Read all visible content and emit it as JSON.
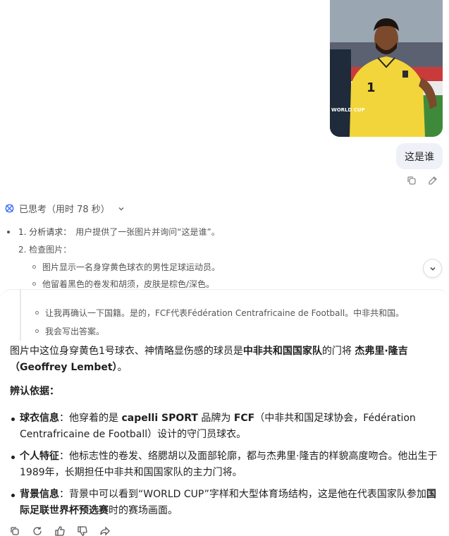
{
  "user_message": {
    "text": "这是谁"
  },
  "thinking": {
    "header": "已思考（用时 78 秒）",
    "step1_label": "1. 分析请求：",
    "step1_text": "用户提供了一张图片并询问“这是谁”。",
    "step2_label": "2. 检查图片：",
    "step2_items": [
      "图片显示一名身穿黄色球衣的男性足球运动员。",
      "他留着黑色的卷发和胡须，皮肤是棕色/深色。"
    ],
    "tail_items": [
      "让我再确认一下国籍。是的，FCF代表Fédération Centrafricaine de Football。中非共和国。",
      "我会写出答案。"
    ]
  },
  "answer": {
    "intro_pre": "图片中这位身穿黄色1号球衣、神情略显伤感的球员是",
    "intro_team": "中非共和国国家队",
    "intro_mid": "的门将 ",
    "intro_name": "杰弗里·隆吉（Geoffrey Lembet）",
    "intro_end": "。",
    "basis_title": "辨认依据：",
    "bullet1_title": "球衣信息",
    "bullet1_a": "：他穿着的是 ",
    "bullet1_brand": "capelli SPORT",
    "bullet1_b": " 品牌为 ",
    "bullet1_fcf": "FCF",
    "bullet1_c": "（中非共和国足球协会，Fédération Centrafricaine de Football）设计的守门员球衣。",
    "bullet2_title": "个人特征",
    "bullet2_text": "：他标志性的卷发、络腮胡以及面部轮廓，都与杰弗里·隆吉的样貌高度吻合。他出生于1989年，长期担任中非共和国国家队的主力门将。",
    "bullet3_title": "背景信息",
    "bullet3_a": "：背景中可以看到“WORLD CUP”字样和大型体育场结构，这是他在代表国家队参加",
    "bullet3_bold": "国际足联世界杯预选赛",
    "bullet3_b": "时的赛场画面。"
  },
  "photo": {
    "jersey_number": "1",
    "banner_text": "WORLD CUP"
  },
  "icons": {
    "user_actions": [
      "copy-icon",
      "edit-icon"
    ],
    "answer_actions": [
      "copy-icon",
      "regenerate-icon",
      "thumbs-up-icon",
      "thumbs-down-icon",
      "share-icon"
    ]
  },
  "colors": {
    "jersey": "#f2d53a",
    "bubble": "#eef1f7",
    "accent_logo": "#3b6cf6"
  }
}
